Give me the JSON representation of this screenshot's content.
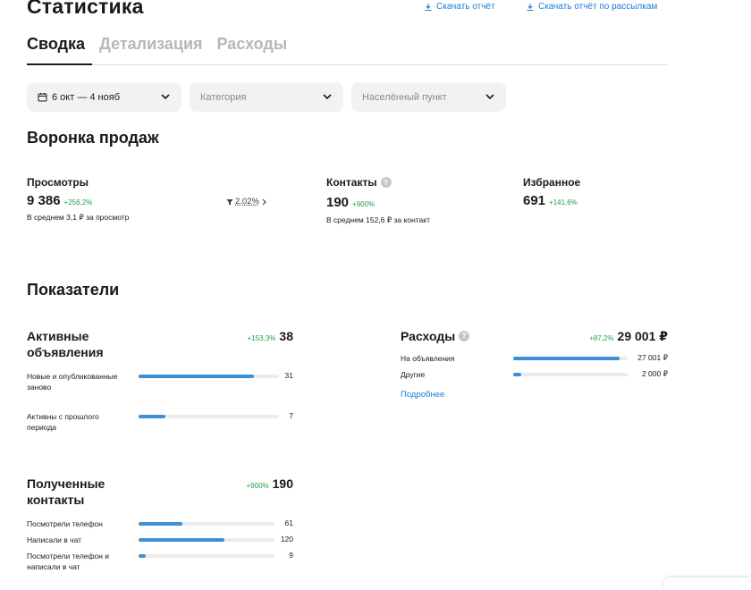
{
  "page": {
    "title": "Статистика",
    "download_report": "Скачать отчёт",
    "download_mailing_report": "Скачать отчёт по рассылкам"
  },
  "tabs": [
    {
      "label": "Сводка",
      "active": true
    },
    {
      "label": "Детализация",
      "active": false
    },
    {
      "label": "Расходы",
      "active": false
    }
  ],
  "filters": {
    "date": "6 окт — 4 нояб",
    "category_placeholder": "Категория",
    "location_placeholder": "Населённый пункт"
  },
  "funnel": {
    "heading": "Воронка продаж",
    "views": {
      "label": "Просмотры",
      "value": "9 386",
      "delta": "+256,2%",
      "sub": "В среднем 3,1 ₽ за просмотр"
    },
    "conversion": "2,02%",
    "contacts": {
      "label": "Контакты",
      "value": "190",
      "delta": "+900%",
      "sub": "В среднем 152,6 ₽ за контакт"
    },
    "favorites": {
      "label": "Избранное",
      "value": "691",
      "delta": "+141,6%"
    }
  },
  "indicators": {
    "heading": "Показатели",
    "active_ads": {
      "title": "Активные объявления",
      "delta": "+153,3%",
      "total": "38",
      "rows": [
        {
          "label": "Новые и опубликованные заново",
          "value": "31",
          "fraction": 0.82
        },
        {
          "label": "Активны с прошлого периода",
          "value": "7",
          "fraction": 0.19
        }
      ]
    },
    "expenses": {
      "title": "Расходы",
      "delta": "+87,2%",
      "total": "29 001 ₽",
      "rows": [
        {
          "label": "На объявления",
          "value": "27 001 ₽",
          "fraction": 0.93
        },
        {
          "label": "Другие",
          "value": "2 000 ₽",
          "fraction": 0.07
        }
      ],
      "more_link": "Подробнее"
    },
    "contacts_received": {
      "title": "Полученные контакты",
      "delta": "+900%",
      "total": "190",
      "rows": [
        {
          "label": "Посмотрели телефон",
          "value": "61",
          "fraction": 0.32
        },
        {
          "label": "Написали в чат",
          "value": "120",
          "fraction": 0.63
        },
        {
          "label": "Посмотрели телефон и написали в чат",
          "value": "9",
          "fraction": 0.05
        }
      ]
    }
  },
  "colors": {
    "accent": "#1f7ad6",
    "bar": "#3d8fd9",
    "positive": "#23a046",
    "track": "#ececec"
  }
}
